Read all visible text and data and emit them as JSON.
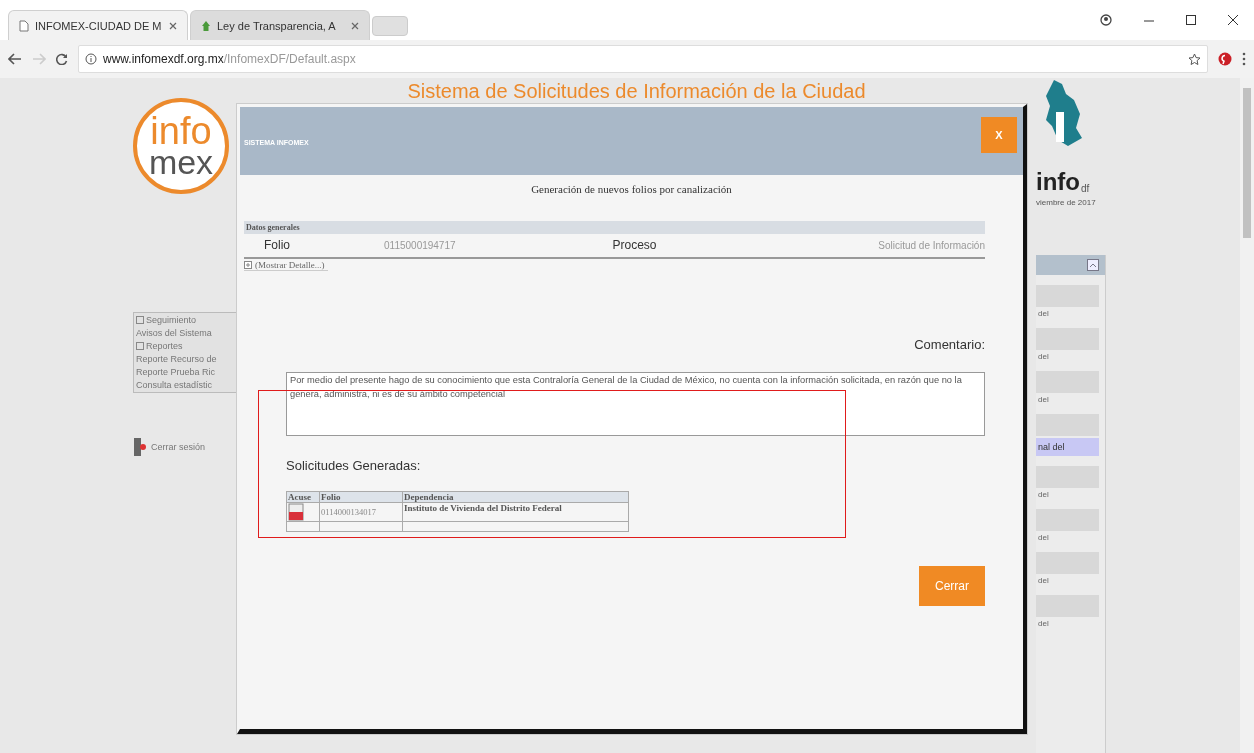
{
  "browser": {
    "tabs": [
      {
        "title": "INFOMEX-CIUDAD DE M",
        "selected": true
      },
      {
        "title": "Ley de Transparencia, A",
        "selected": false
      }
    ],
    "url_host": "www.infomexdf.org.mx",
    "url_path": "/InfomexDF/Default.aspx"
  },
  "page": {
    "logo_top": "info",
    "logo_bottom": "mex",
    "title": "Sistema de Solicitudes de Información de la Ciudad",
    "right_logo": "info",
    "right_logo_suffix": "df",
    "date": "viembre de 2017",
    "menu": [
      {
        "label": "Seguimiento",
        "kind": "group"
      },
      {
        "label": "Avisos del Sistema",
        "kind": "item"
      },
      {
        "label": "Reportes",
        "kind": "group"
      },
      {
        "label": "Reporte Recurso de",
        "kind": "item"
      },
      {
        "label": "Reporte Prueba Ric",
        "kind": "item"
      },
      {
        "label": "Consulta estadístic",
        "kind": "item"
      }
    ],
    "logout": "Cerrar sesión",
    "side_rows": [
      {
        "text": "del",
        "highlighted": false
      },
      {
        "text": "del",
        "highlighted": false
      },
      {
        "text": "del",
        "highlighted": false
      },
      {
        "text": "nal del",
        "highlighted": true
      },
      {
        "text": "del",
        "highlighted": false
      },
      {
        "text": "del",
        "highlighted": false
      },
      {
        "text": "del",
        "highlighted": false
      },
      {
        "text": "del",
        "highlighted": false
      }
    ]
  },
  "dialog": {
    "header": "SISTEMA INFOMEX",
    "close_label": "X",
    "subtitle": "Generación de nuevos folios por canalización",
    "section": "Datos generales",
    "fields": [
      {
        "label": "Folio",
        "value": "0115000194717"
      },
      {
        "label": "Proceso",
        "value": "Solicitud de Información"
      }
    ],
    "details_link": "(Mostrar Detalle...)",
    "comment_label": "Comentario:",
    "comment": "Por medio del presente hago de su conocimiento que esta Contraloría General de la Ciudad de México, no cuenta con la información solicitada, en razón que no la genera, administra, ni es de su ámbito competencial",
    "generated_label": "Solicitudes Generadas:",
    "table": {
      "columns": [
        "Acuse",
        "Folio",
        "Dependencia"
      ],
      "rows": [
        {
          "folio": "0114000134017",
          "dependencia": "Instituto de Vivienda del Distrito Federal"
        }
      ]
    },
    "close_button": "Cerrar"
  }
}
